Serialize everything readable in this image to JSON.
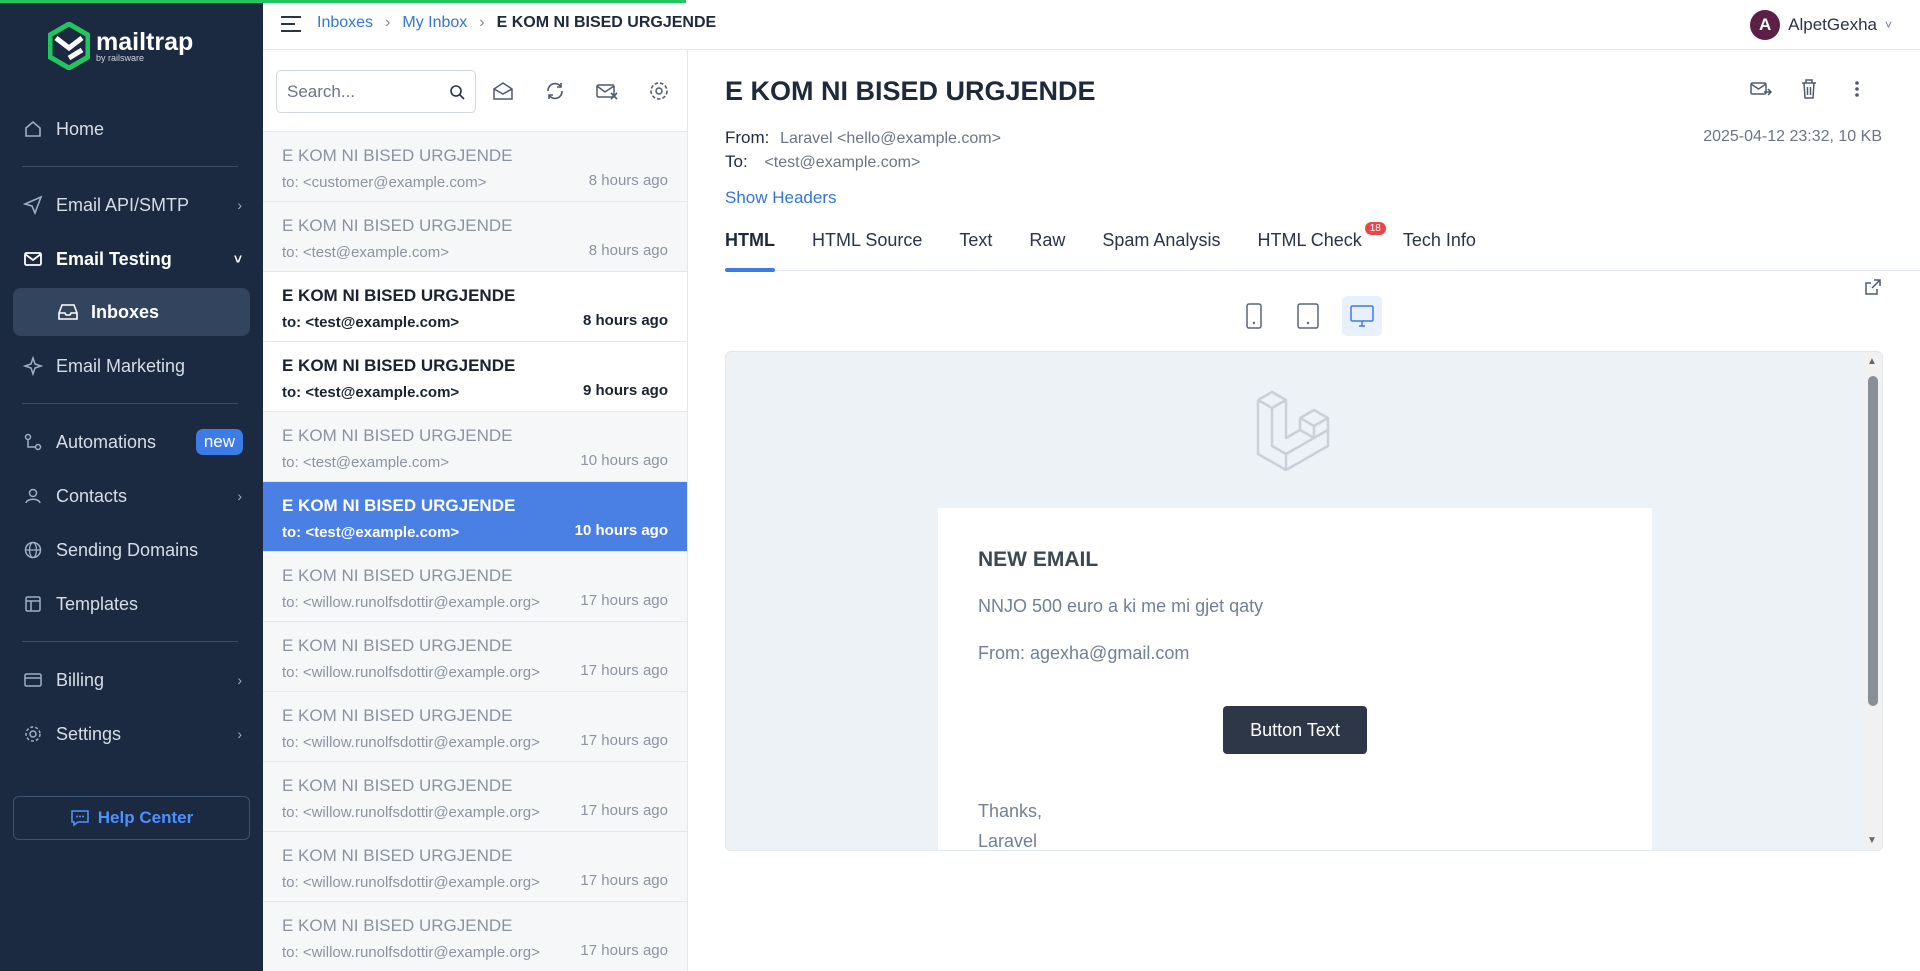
{
  "brand": {
    "name": "mailtrap",
    "tagline": "by railsware"
  },
  "sidebar": {
    "items": [
      {
        "label": "Home"
      },
      {
        "label": "Email API/SMTP"
      },
      {
        "label": "Email Testing"
      },
      {
        "label": "Inboxes"
      },
      {
        "label": "Email Marketing"
      },
      {
        "label": "Automations",
        "badge": "new"
      },
      {
        "label": "Contacts"
      },
      {
        "label": "Sending Domains"
      },
      {
        "label": "Templates"
      },
      {
        "label": "Billing"
      },
      {
        "label": "Settings"
      }
    ],
    "help": "Help Center"
  },
  "header": {
    "breadcrumb": [
      "Inboxes",
      "My Inbox",
      "E KOM NI BISED URGJENDE"
    ],
    "user": {
      "initial": "A",
      "name": "AlpetGexha"
    }
  },
  "list": {
    "search_placeholder": "Search...",
    "messages": [
      {
        "subject": "E KOM NI BISED URGJENDE",
        "to": "to: <customer@example.com>",
        "time": "8 hours ago",
        "state": "read"
      },
      {
        "subject": "E KOM NI BISED URGJENDE",
        "to": "to: <test@example.com>",
        "time": "8 hours ago",
        "state": "read"
      },
      {
        "subject": "E KOM NI BISED URGJENDE",
        "to": "to: <test@example.com>",
        "time": "8 hours ago",
        "state": "unread"
      },
      {
        "subject": "E KOM NI BISED URGJENDE",
        "to": "to: <test@example.com>",
        "time": "9 hours ago",
        "state": "unread"
      },
      {
        "subject": "E KOM NI BISED URGJENDE",
        "to": "to: <test@example.com>",
        "time": "10 hours ago",
        "state": "read"
      },
      {
        "subject": "E KOM NI BISED URGJENDE",
        "to": "to: <test@example.com>",
        "time": "10 hours ago",
        "state": "selected"
      },
      {
        "subject": "E KOM NI BISED URGJENDE",
        "to": "to: <willow.runolfsdottir@example.org>",
        "time": "17 hours ago",
        "state": "read"
      },
      {
        "subject": "E KOM NI BISED URGJENDE",
        "to": "to: <willow.runolfsdottir@example.org>",
        "time": "17 hours ago",
        "state": "read"
      },
      {
        "subject": "E KOM NI BISED URGJENDE",
        "to": "to: <willow.runolfsdottir@example.org>",
        "time": "17 hours ago",
        "state": "read"
      },
      {
        "subject": "E KOM NI BISED URGJENDE",
        "to": "to: <willow.runolfsdottir@example.org>",
        "time": "17 hours ago",
        "state": "read"
      },
      {
        "subject": "E KOM NI BISED URGJENDE",
        "to": "to: <willow.runolfsdottir@example.org>",
        "time": "17 hours ago",
        "state": "read"
      },
      {
        "subject": "E KOM NI BISED URGJENDE",
        "to": "to: <willow.runolfsdottir@example.org>",
        "time": "17 hours ago",
        "state": "read"
      }
    ]
  },
  "detail": {
    "subject": "E KOM NI BISED URGJENDE",
    "from_label": "From:",
    "from": "Laravel <hello@example.com>",
    "to_label": "To:",
    "to": "<test@example.com>",
    "date": "2025-04-12 23:32, 10 KB",
    "show_headers": "Show Headers",
    "tabs": [
      "HTML",
      "HTML Source",
      "Text",
      "Raw",
      "Spam Analysis",
      "HTML Check",
      "Tech Info"
    ],
    "html_check_count": "18",
    "email": {
      "title": "NEW EMAIL",
      "line1": "NNJO 500 euro a ki me mi gjet qaty",
      "line2": "From: agexha@gmail.com",
      "button": "Button Text",
      "thanks": "Thanks,",
      "signature": "Laravel"
    }
  },
  "colors": {
    "accent": "#3b7be6",
    "sidebar": "#1b2a40",
    "progress": "#22c55e",
    "badge": "#e54848"
  }
}
